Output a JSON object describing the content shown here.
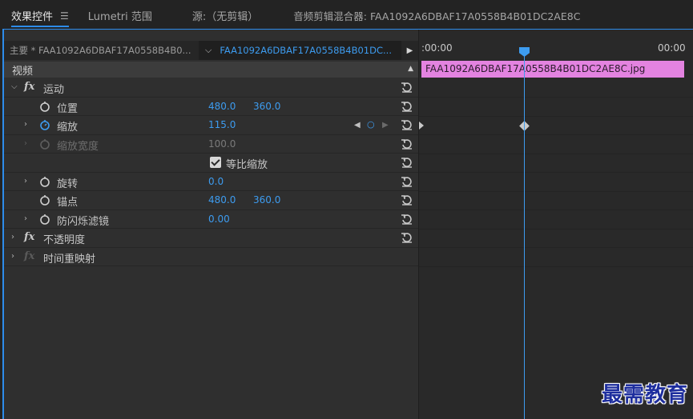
{
  "tabs": [
    {
      "label": "效果控件",
      "active": true
    },
    {
      "label": "Lumetri 范围",
      "active": false
    },
    {
      "label": "源:（无剪辑）",
      "active": false
    },
    {
      "label": "音频剪辑混合器: FAA1092A6DBAF17A0558B4B01DC2AE8C",
      "active": false
    }
  ],
  "tab_menu_icon": "hamburger-icon",
  "sequence": {
    "master": "主要 * FAA1092A6DBAF17A0558B4B0...",
    "clip": "FAA1092A6DBAF17A0558B4B01DC..."
  },
  "section": {
    "title": "视频"
  },
  "effects": {
    "motion": {
      "label": "运动"
    },
    "position": {
      "label": "位置",
      "x": "480.0",
      "y": "360.0"
    },
    "scale": {
      "label": "缩放",
      "value": "115.0"
    },
    "scale_width": {
      "label": "缩放宽度",
      "value": "100.0"
    },
    "uniform_scale": {
      "label": "等比缩放",
      "checked": true
    },
    "rotation": {
      "label": "旋转",
      "value": "0.0"
    },
    "anchor": {
      "label": "锚点",
      "x": "480.0",
      "y": "360.0"
    },
    "antiflicker": {
      "label": "防闪烁滤镜",
      "value": "0.00"
    },
    "opacity": {
      "label": "不透明度"
    },
    "time_remap": {
      "label": "时间重映射"
    }
  },
  "fx_label": "fx",
  "timeline": {
    "tc_start": ":00:00",
    "tc_end": "00:00",
    "clip_name": "FAA1092A6DBAF17A0558B4B01DC2AE8C.jpg"
  },
  "watermark": "最需教育",
  "colors": {
    "accent": "#3d9cf0",
    "clip": "#e383e0",
    "panel": "#2f2f2f"
  }
}
